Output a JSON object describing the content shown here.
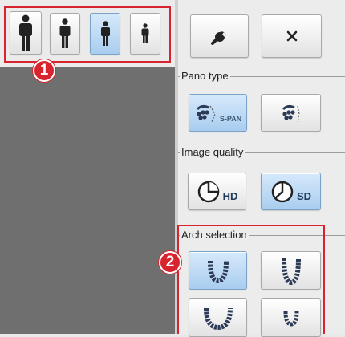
{
  "toolbar": {
    "patient_sizes": [
      {
        "icon": "patient-large-icon",
        "selected": false
      },
      {
        "icon": "patient-medium-icon",
        "selected": false
      },
      {
        "icon": "patient-small-icon",
        "selected": true
      },
      {
        "icon": "patient-child-icon",
        "selected": false
      }
    ],
    "callout_1": "1",
    "callout_2": "2",
    "tools_icon": "wrench-icon",
    "close_icon": "close-icon"
  },
  "pano_type": {
    "label": "Pano type",
    "options": [
      {
        "icon": "s-pan-icon",
        "text": "S-PAN",
        "selected": true
      },
      {
        "icon": "pano-standard-icon",
        "text": "",
        "selected": false
      }
    ]
  },
  "image_quality": {
    "label": "Image quality",
    "options": [
      {
        "icon": "quality-hd-icon",
        "text": "HD",
        "selected": false
      },
      {
        "icon": "quality-sd-icon",
        "text": "SD",
        "selected": true
      }
    ]
  },
  "arch_selection": {
    "label": "Arch selection",
    "options": [
      {
        "icon": "arch-narrow-icon",
        "selected": true
      },
      {
        "icon": "arch-tall-icon",
        "selected": false
      },
      {
        "icon": "arch-wide-icon",
        "selected": false
      },
      {
        "icon": "arch-small-icon",
        "selected": false
      }
    ]
  },
  "colors": {
    "highlight": "#d8242e",
    "selected_bg": "#b5d5f2",
    "viewport": "#6f6f6f"
  }
}
